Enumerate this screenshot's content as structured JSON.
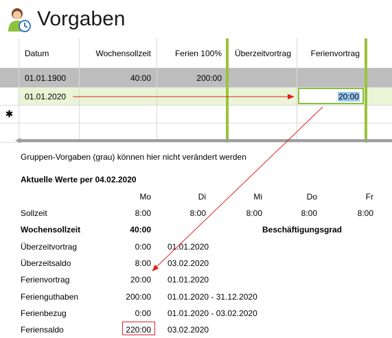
{
  "header": {
    "title": "Vorgaben",
    "icon": "user-clock-icon"
  },
  "grid": {
    "columns": [
      "Datum",
      "Wochensollzeit",
      "Ferien 100%",
      "Überzeitvortrag",
      "Ferienvortrag"
    ],
    "rows": [
      {
        "datum": "01.01.1900",
        "wochensollzeit": "40:00",
        "ferien": "200:00",
        "ueberzeit": "",
        "ferienvortrag": ""
      },
      {
        "datum": "01.01.2020",
        "wochensollzeit": "",
        "ferien": "",
        "ueberzeit": "",
        "ferienvortrag": "20:00"
      }
    ],
    "new_row_marker": "✱"
  },
  "info": {
    "note": "Gruppen-Vorgaben (grau) können hier nicht verändert werden"
  },
  "current": {
    "heading": "Aktuelle Werte per 04.02.2020",
    "days": [
      "Mo",
      "Di",
      "Mi",
      "Do",
      "Fr"
    ],
    "sollzeit": {
      "label": "Sollzeit",
      "values": [
        "8:00",
        "8:00",
        "8:00",
        "8:00",
        "8:00"
      ]
    },
    "wochensollzeit": {
      "label": "Wochensollzeit",
      "value": "40:00"
    },
    "beschaeftigungsgrad": {
      "label": "Beschäftigungsgrad"
    },
    "rows": [
      {
        "label": "Überzeitvortrag",
        "value": "0:00",
        "date": "01.01.2020"
      },
      {
        "label": "Überzeitsaldo",
        "value": "8:00",
        "date": "03.02.2020"
      },
      {
        "label": "Ferienvortrag",
        "value": "20:00",
        "date": "01.01.2020"
      },
      {
        "label": "Ferienguthaben",
        "value": "200:00",
        "date": "01.01.2020 - 31.12.2020"
      },
      {
        "label": "Ferienbezug",
        "value": "0:00",
        "date": "01.01.2020 - 03.02.2020"
      },
      {
        "label": "Feriensaldo",
        "value": "220:00",
        "date": "03.02.2020"
      }
    ]
  },
  "colors": {
    "accent_green": "#9ac33c",
    "arrow_red": "#e02020",
    "gray_row": "#bdbdbd",
    "green_row": "#eaf4d6"
  }
}
